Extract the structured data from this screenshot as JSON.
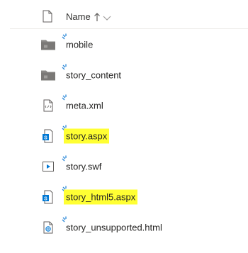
{
  "header": {
    "column_name_label": "Name",
    "sort_direction": "ascending"
  },
  "files": [
    {
      "name": "mobile",
      "icon": "folder-icon",
      "highlighted": false
    },
    {
      "name": "story_content",
      "icon": "folder-icon",
      "highlighted": false
    },
    {
      "name": "meta.xml",
      "icon": "xml-file-icon",
      "highlighted": false
    },
    {
      "name": "story.aspx",
      "icon": "sharepoint-aspx-icon",
      "highlighted": true
    },
    {
      "name": "story.swf",
      "icon": "video-file-icon",
      "highlighted": false
    },
    {
      "name": "story_html5.aspx",
      "icon": "sharepoint-aspx-icon",
      "highlighted": true
    },
    {
      "name": "story_unsupported.html",
      "icon": "html-file-icon",
      "highlighted": false
    }
  ],
  "colors": {
    "highlight": "#ffff33",
    "accent_blue": "#0078d4",
    "sync_blue": "#2b88d8",
    "folder_gray": "#8a8886"
  }
}
